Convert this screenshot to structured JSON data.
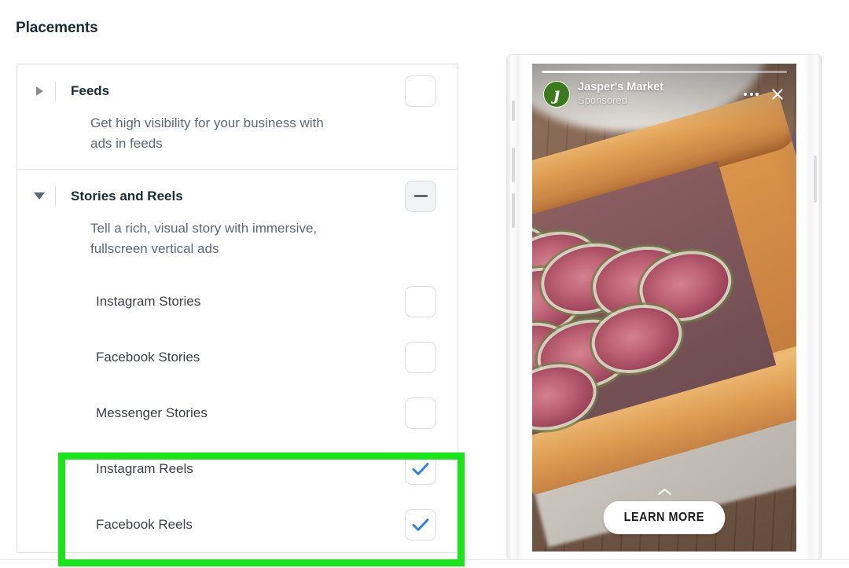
{
  "page": {
    "title": "Placements"
  },
  "placements": {
    "groups": [
      {
        "id": "feeds",
        "name": "Feeds",
        "description": "Get high visibility for your business with ads in feeds",
        "expanded": false,
        "caret_icon": "caret-right-icon",
        "checkbox_state": "unchecked",
        "children": []
      },
      {
        "id": "stories-and-reels",
        "name": "Stories and Reels",
        "description": "Tell a rich, visual story with immersive, fullscreen vertical ads",
        "expanded": true,
        "caret_icon": "caret-down-icon",
        "checkbox_state": "indeterminate",
        "children": [
          {
            "id": "instagram-stories",
            "label": "Instagram Stories",
            "checkbox_state": "unchecked",
            "highlighted": false
          },
          {
            "id": "facebook-stories",
            "label": "Facebook Stories",
            "checkbox_state": "unchecked",
            "highlighted": false
          },
          {
            "id": "messenger-stories",
            "label": "Messenger Stories",
            "checkbox_state": "unchecked",
            "highlighted": false
          },
          {
            "id": "instagram-reels",
            "label": "Instagram Reels",
            "checkbox_state": "checked",
            "highlighted": true
          },
          {
            "id": "facebook-reels",
            "label": "Facebook Reels",
            "checkbox_state": "checked",
            "highlighted": true
          }
        ]
      }
    ]
  },
  "highlight": {
    "color": "#19e619",
    "targets": [
      "instagram-reels",
      "facebook-reels"
    ]
  },
  "preview": {
    "device": "phone-mockup",
    "story": {
      "progress_percent": 40,
      "brand_name": "Jasper's Market",
      "brand_logo_glyph": "ȷ",
      "sponsored_label": "Sponsored",
      "more_options_icon": "ellipsis-icon",
      "close_icon": "close-icon",
      "swipe_up_icon": "chevron-up-icon",
      "cta_label": "LEARN MORE",
      "creative_description": "Fig tart on a baking tray on a wooden table"
    }
  },
  "colors": {
    "checkbox_check": "#2c7df0",
    "highlight_green": "#19e619",
    "brand_logo_green": "#3d7a1e",
    "panel_border": "#dddfe2",
    "text_primary": "#1c2b33",
    "text_secondary": "#606770"
  }
}
